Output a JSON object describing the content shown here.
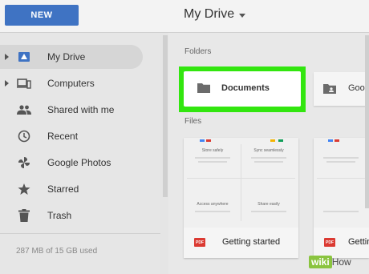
{
  "header": {
    "new_button": "NEW",
    "title": "My Drive"
  },
  "sidebar": {
    "items": [
      {
        "label": "My Drive",
        "icon": "drive-icon",
        "active": true
      },
      {
        "label": "Computers",
        "icon": "computers-icon"
      },
      {
        "label": "Shared with me",
        "icon": "shared-people-icon"
      },
      {
        "label": "Recent",
        "icon": "clock-icon"
      },
      {
        "label": "Google Photos",
        "icon": "pinwheel-icon"
      },
      {
        "label": "Starred",
        "icon": "star-icon"
      },
      {
        "label": "Trash",
        "icon": "trash-icon"
      }
    ],
    "storage": "287 MB of 15 GB used"
  },
  "main": {
    "folders_heading": "Folders",
    "folders": [
      {
        "label": "Documents",
        "highlight_color": "#32e60f"
      },
      {
        "label": "Goog"
      }
    ],
    "files_heading": "Files",
    "files": [
      {
        "label": "Getting started",
        "badge": "PDF",
        "thumb": [
          "Store safely",
          "Sync seamlessly",
          "Access anywhere",
          "Share easily"
        ]
      },
      {
        "label": "Getting",
        "badge": "PDF",
        "thumb": [
          "",
          "",
          "",
          ""
        ]
      }
    ]
  },
  "watermark": {
    "prefix": "wiki",
    "suffix": "How"
  },
  "colors": {
    "accent": "#3f73c3",
    "pdf_red": "#db3a32",
    "highlight": "#32e60f"
  }
}
